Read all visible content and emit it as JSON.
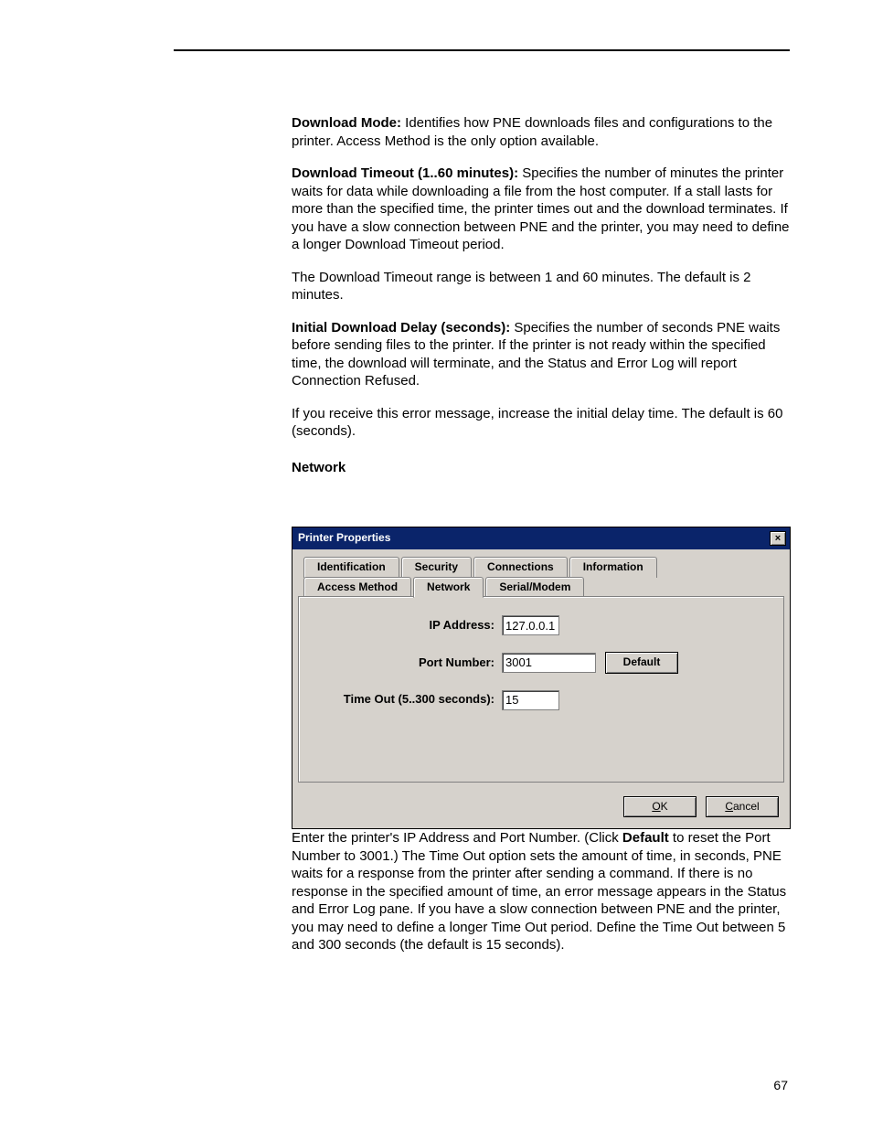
{
  "page_number": "67",
  "text": {
    "p1a": "Download Mode:",
    "p1b": " Identifies how PNE downloads files and configurations to the printer. Access Method is the only option available.",
    "p2a": "Download Timeout (1..60 minutes):",
    "p2b": " Specifies the number of minutes the printer waits for data while downloading a file from the host computer. If a stall lasts for more than the specified time, the printer times out and the download terminates. If you have a slow connection between PNE and the printer, you may need to define a longer Download Timeout period.",
    "p3": "The Download Timeout range is between 1 and 60 minutes. The default is 2 minutes.",
    "p4a": "Initial Download Delay (seconds):",
    "p4b": " Specifies the number of seconds PNE waits before sending files to the printer. If the printer is not ready within the specified time, the download will terminate, and the Status and Error Log will report Connection Refused.",
    "p5": "If you receive this error message, increase the initial delay time. The default is 60 (seconds).",
    "section_head": "Network",
    "after1a": "Enter the printer's IP Address and Port Number. (Click ",
    "after1b": "Default",
    "after1c": " to reset the Port Number to 3001.) The Time Out option sets the amount of time, in seconds, PNE waits for a response from the printer after sending a command. If there is no response in the specified amount of time, an error message appears in the Status and Error Log pane. If you have a slow connection between PNE and the printer, you may need to define a longer Time Out period. Define the Time Out between 5 and 300 seconds (the default is 15 seconds)."
  },
  "dialog": {
    "title": "Printer Properties",
    "close": "×",
    "tabs_row1": {
      "t1": "Identification",
      "t2": "Security",
      "t3": "Connections",
      "t4": "Information"
    },
    "tabs_row2": {
      "t1": "Access Method",
      "t2": "Network",
      "t3": "Serial/Modem"
    },
    "labels": {
      "ip": "IP Address:",
      "port": "Port Number:",
      "timeout": "Time Out (5..300 seconds):"
    },
    "values": {
      "ip": "127.0.0.1",
      "port": "3001",
      "timeout": "15"
    },
    "buttons": {
      "default": "Default",
      "ok_u": "O",
      "ok_rest": "K",
      "cancel_u": "C",
      "cancel_rest": "ancel"
    }
  }
}
